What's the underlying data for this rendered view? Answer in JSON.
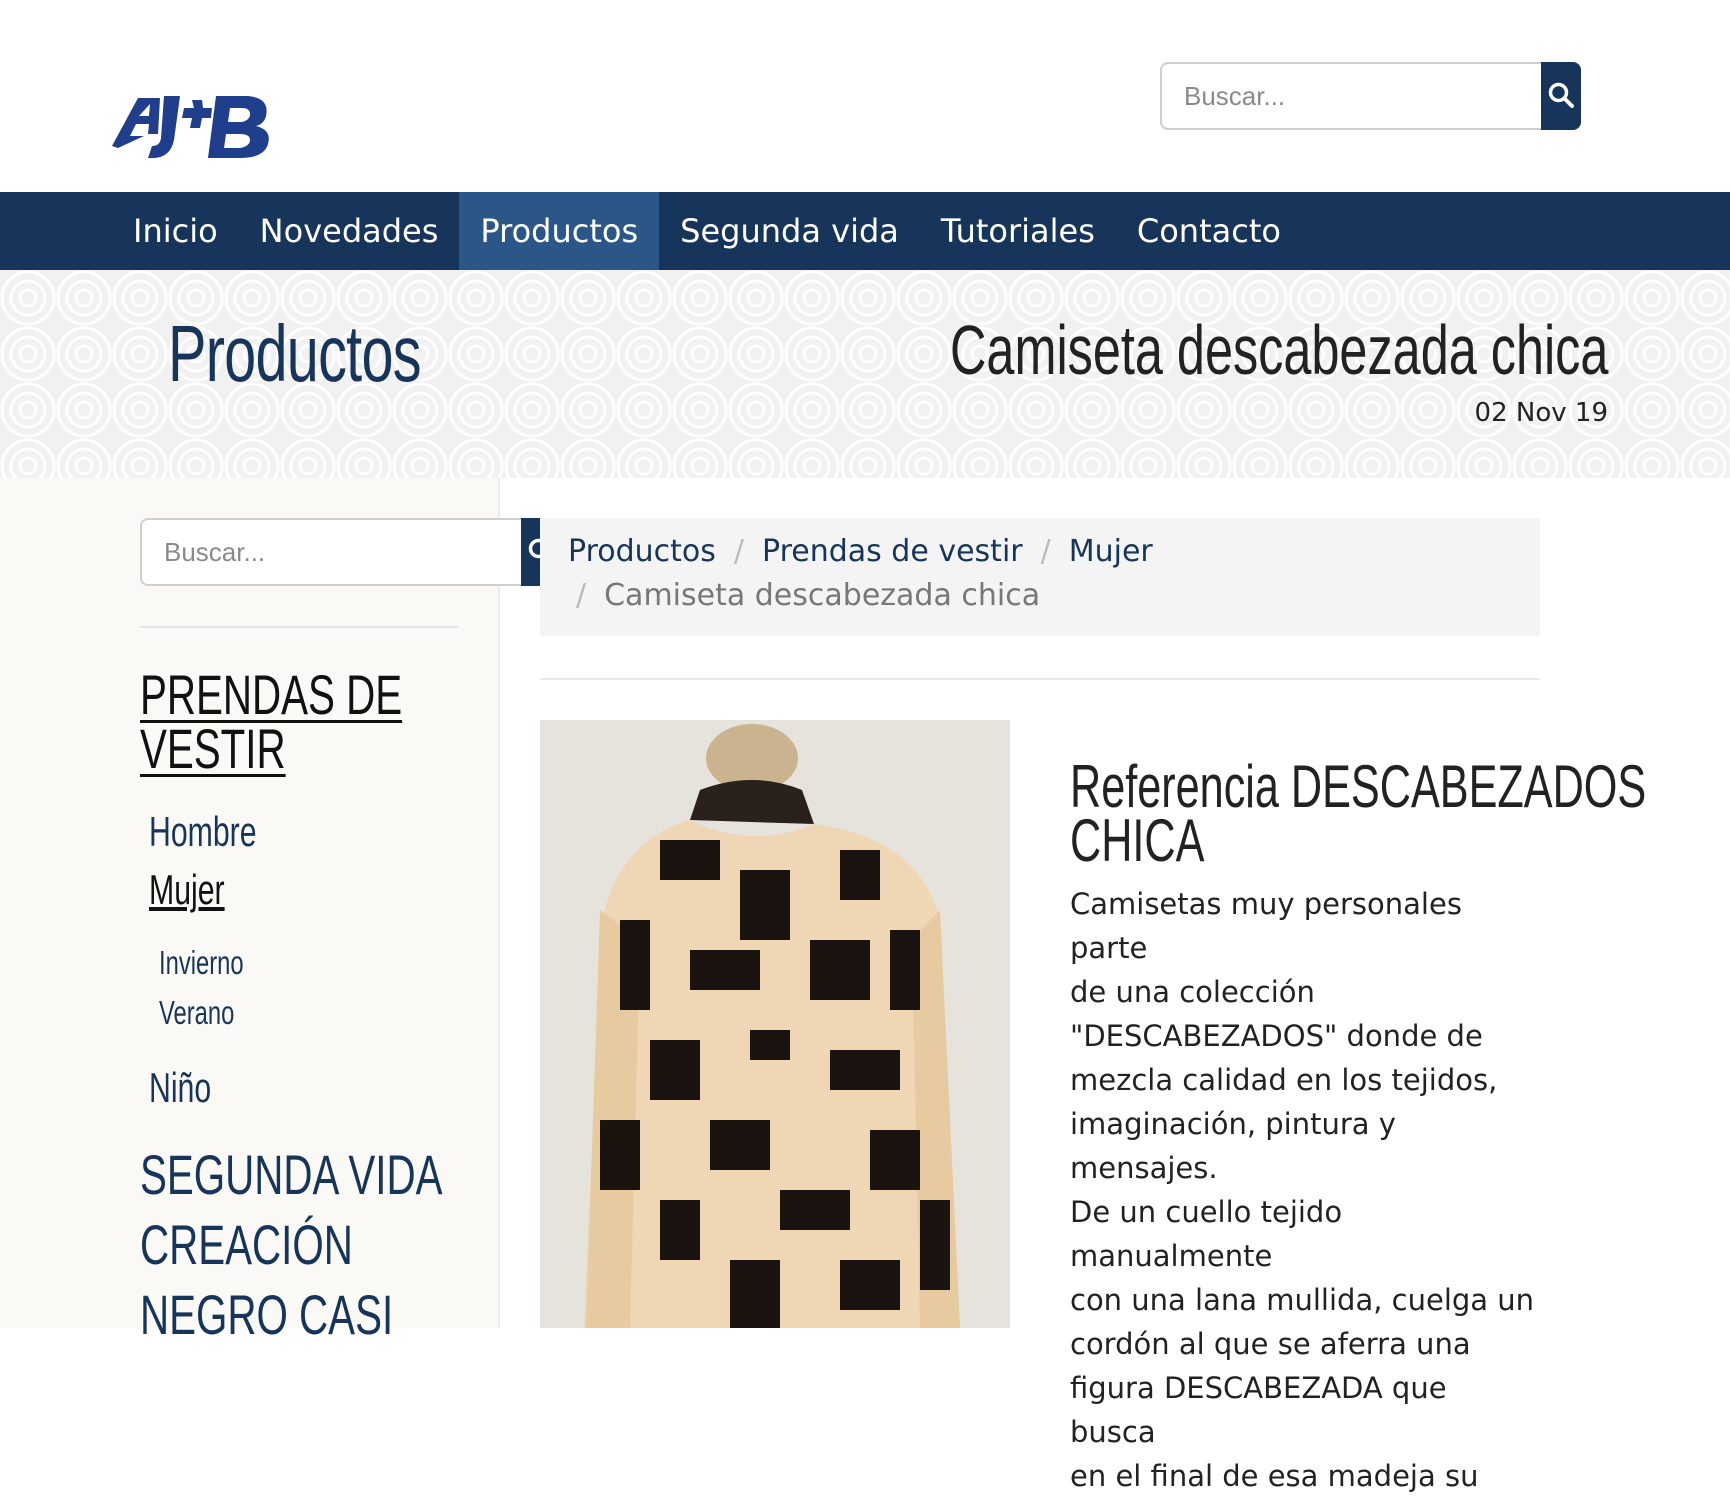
{
  "header": {
    "logo_text": "AJ+B",
    "search": {
      "placeholder": "Buscar..."
    }
  },
  "nav": {
    "items": [
      {
        "label": "Inicio",
        "active": false
      },
      {
        "label": "Novedades",
        "active": false
      },
      {
        "label": "Productos",
        "active": true
      },
      {
        "label": "Segunda vida",
        "active": false
      },
      {
        "label": "Tutoriales",
        "active": false
      },
      {
        "label": "Contacto",
        "active": false
      }
    ]
  },
  "banner": {
    "section_title": "Productos",
    "page_title": "Camiseta descabezada chica",
    "date": "02 Nov 19"
  },
  "sidebar": {
    "search": {
      "placeholder": "Buscar..."
    },
    "category_title_line1": "PRENDAS DE",
    "category_title_line2": "VESTIR",
    "items": [
      {
        "label": "Hombre"
      },
      {
        "label": "Mujer",
        "active": true
      },
      {
        "label": "Invierno"
      },
      {
        "label": "Verano"
      },
      {
        "label": "Niño"
      }
    ],
    "sections": [
      {
        "label": "SEGUNDA VIDA"
      },
      {
        "label": "CREACIÓN"
      },
      {
        "label": "NEGRO CASI"
      }
    ]
  },
  "breadcrumb": {
    "items": [
      "Productos",
      "Prendas de vestir",
      "Mujer"
    ],
    "current": "Camiseta descabezada chica",
    "separator": "/"
  },
  "product": {
    "reference_line1": "Referencia DESCABEZADOS",
    "reference_line2": "CHICA",
    "description": [
      "Camisetas muy personales parte",
      "de una colección",
      "\"DESCABEZADOS\" donde de",
      "mezcla calidad en los tejidos,",
      "imaginación, pintura y mensajes.",
      "De un cuello tejido manualmente",
      "con una lana mullida, cuelga un",
      "cordón al que se aferra una",
      "figura DESCABEZADA que busca",
      "en el final de esa madeja su"
    ]
  },
  "colors": {
    "primary": "#17355a",
    "nav_active": "#2b5788",
    "text": "#222222",
    "breadcrumb_bg": "#f4f4f4"
  }
}
